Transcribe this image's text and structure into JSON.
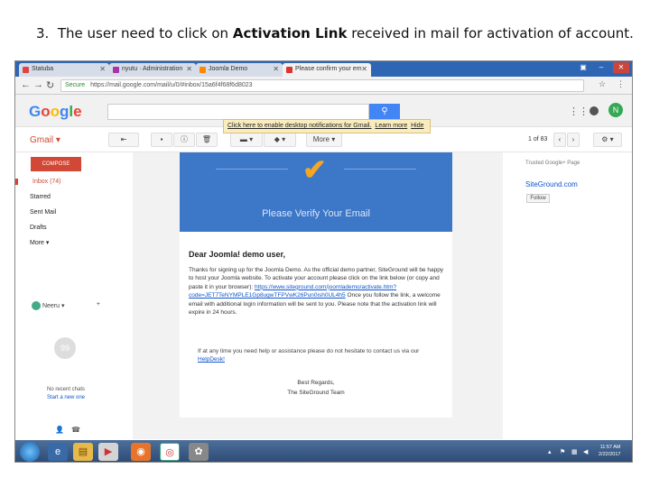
{
  "caption": {
    "number": "3.",
    "before": "The user need to click on",
    "bold": "Activation Link",
    "after": "received in mail for activation of account."
  },
  "browser": {
    "tabs": [
      {
        "label": "Statuba",
        "color": "#d44"
      },
      {
        "label": "nyutu · Administration",
        "color": "#a3a"
      },
      {
        "label": "Joomla Demo",
        "color": "#f80"
      },
      {
        "label": "Please confirm your em",
        "color": "#d33"
      }
    ],
    "url_secure": "Secure",
    "url": "https://mail.google.com/mail/u/0/#inbox/15a6f4f68f6d8023"
  },
  "gmail": {
    "logo": "Google",
    "logo_colors": [
      "#4285f4",
      "#ea4335",
      "#fbbc05",
      "#4285f4",
      "#34a853",
      "#ea4335"
    ],
    "avatar_letter": "N",
    "tooltip_link": "Click here to enable desktop notifications for Gmail.",
    "tooltip_learn": "Learn more",
    "tooltip_hide": "Hide",
    "label": "Gmail ▾",
    "more_btn": "More ▾",
    "pager": "1 of 83",
    "compose": "COMPOSE",
    "nav": [
      "Inbox (74)",
      "Starred",
      "Sent Mail",
      "Drafts",
      "More ▾"
    ],
    "hangouts_user": "Neeru ▾",
    "chat_icon": "99",
    "chat_text_1": "No recent chats",
    "chat_text_2": "Start a new one",
    "right_panel_title": "Trusted Google+ Page",
    "right_panel_link": "SiteGround.com",
    "follow_btn": "Follow"
  },
  "email": {
    "banner_title": "Please Verify Your Email",
    "greeting": "Dear Joomla! demo user,",
    "para_1": "Thanks for signing up for the Joomla Demo. As the official demo partner, SiteGround will be happy to host your Joomla website. To activate your account please click on the link below (or copy and paste it in your browser):",
    "activation_link": "https://www.siteground.com/joomlademo/activate.htm?code=JET7TeNYMPLE1Gp8ugwTFPVwK26Pun0ish0UL4h5",
    "para_2": "Once you follow the link, a welcome email with additional login information will be sent to you. Please note that the activation link will expire in 24 hours.",
    "help_text": "If at any time you need help or assistance please do not hesitate to contact us via our",
    "help_link": "HelpDesk!",
    "sign_1": "Best Regards,",
    "sign_2": "The SiteGround Team"
  },
  "taskbar": {
    "time": "11:57 AM",
    "date": "2/22/2017"
  }
}
